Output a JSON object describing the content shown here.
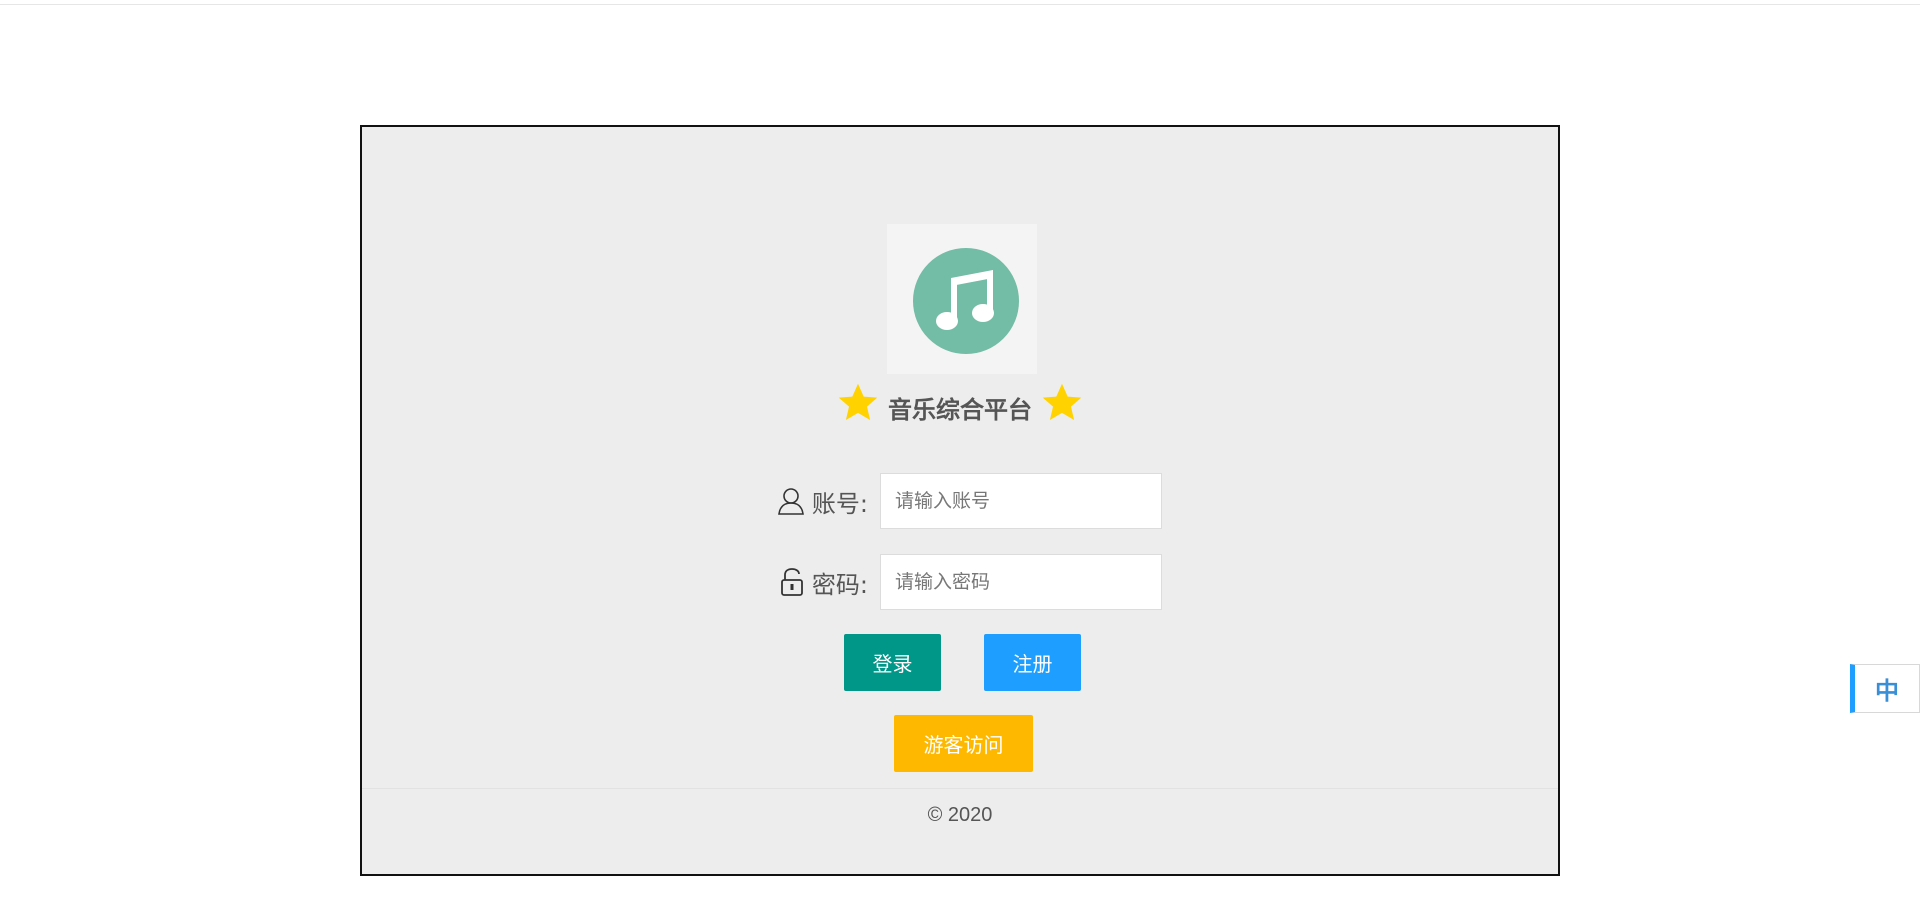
{
  "brand": {
    "title": "音乐综合平台",
    "logo_icon": "music-note-icon",
    "logo_color": "#73bca5",
    "star_color": "#ffd200"
  },
  "form": {
    "account": {
      "label": "账号:",
      "icon": "user-icon",
      "placeholder": "请输入账号",
      "value": ""
    },
    "password": {
      "label": "密码:",
      "icon": "lock-icon",
      "placeholder": "请输入密码",
      "value": ""
    }
  },
  "buttons": {
    "login": {
      "label": "登录",
      "color": "#009688"
    },
    "register": {
      "label": "注册",
      "color": "#1e9fff"
    },
    "guest": {
      "label": "游客访问",
      "color": "#ffb800"
    }
  },
  "footer": {
    "copyright": "© 2020"
  },
  "language_switch": {
    "label": "中",
    "accent": "#1e9fff"
  }
}
